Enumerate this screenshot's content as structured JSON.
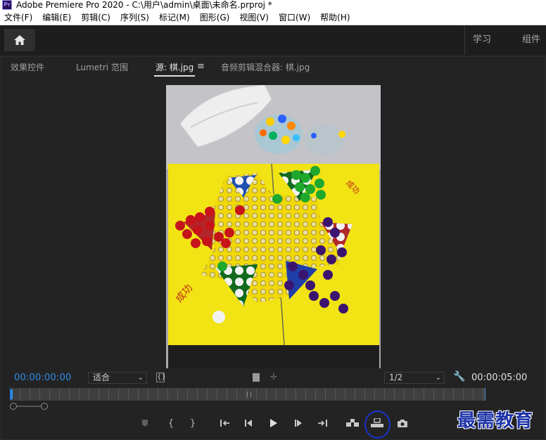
{
  "window": {
    "title": "Adobe Premiere Pro 2020 - C:\\用户\\admin\\桌面\\未命名.prproj *",
    "logo": "Pr"
  },
  "menu": [
    "文件(F)",
    "编辑(E)",
    "剪辑(C)",
    "序列(S)",
    "标记(M)",
    "图形(G)",
    "视图(V)",
    "窗口(W)",
    "帮助(H)"
  ],
  "workspaces": {
    "learn": "学习",
    "assembly": "组件"
  },
  "panel_tabs": {
    "effect_controls": "效果控件",
    "lumetri_scopes": "Lumetri 范围",
    "source": "源: 棋.jpg",
    "audio_mixer": "音频剪辑混合器: 棋.jpg"
  },
  "source_monitor": {
    "current_timecode": "00:00:00:00",
    "fit": "适合",
    "resolution": "1/2",
    "duration_timecode": "00:00:05:00",
    "playhead_fraction": 0
  },
  "watermark": "最需教育",
  "colors": {
    "accent": "#2d8ceb",
    "annotation": "#1a33cc"
  }
}
